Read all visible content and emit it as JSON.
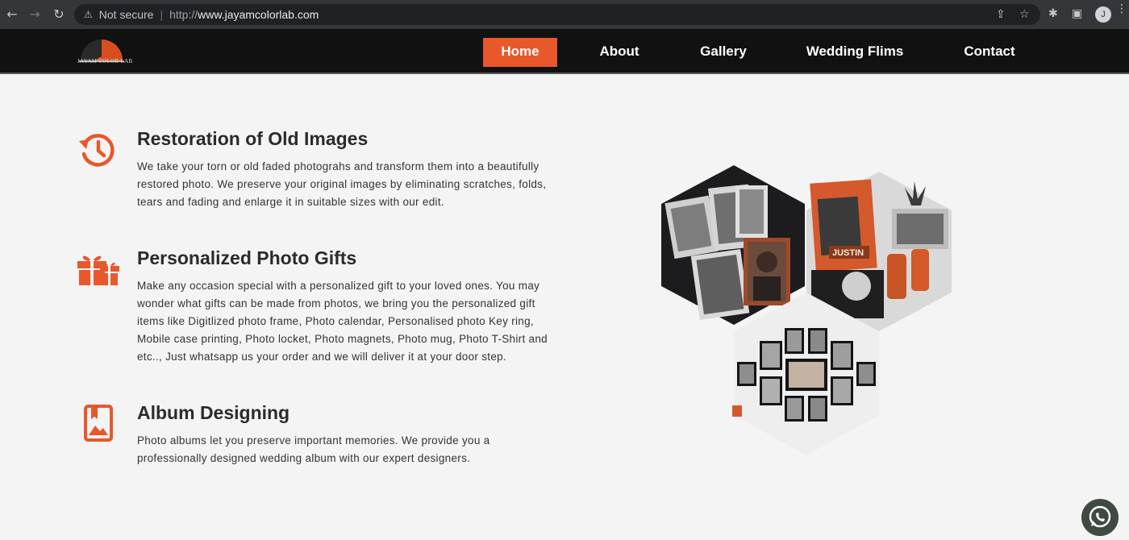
{
  "browser": {
    "security_label": "Not secure",
    "url_prefix": "http://",
    "url_host": "www.jayamcolorlab.com",
    "profile_initial": "J"
  },
  "site": {
    "logo_text": "JAYAM COLOR LAB",
    "nav": [
      {
        "label": "Home",
        "active": true
      },
      {
        "label": "About",
        "active": false
      },
      {
        "label": "Gallery",
        "active": false
      },
      {
        "label": "Wedding Flims",
        "active": false
      },
      {
        "label": "Contact",
        "active": false
      }
    ],
    "accent_color": "#e8582a"
  },
  "features": [
    {
      "icon": "history-icon",
      "title": "Restoration of Old Images",
      "lines": [
        "We take your torn or old faded photograhs and transform them into a beautifully",
        "restored photo. We preserve your original images by eliminating scratches, folds,",
        "tears and fading and enlarge it in suitable sizes with our edit."
      ]
    },
    {
      "icon": "gift-icon",
      "title": "Personalized Photo Gifts",
      "lines": [
        "Make any occasion special with a personalized gift to your loved ones. You may",
        "wonder what gifts can be made from photos, we bring you the personalized gift",
        "items like Digitlized photo frame, Photo calendar, Personalised photo Key ring,",
        "Mobile case printing, Photo locket, Photo magnets, Photo mug, Photo T-Shirt and",
        "etc.., Just whatsapp us your order and we will deliver it at your door step."
      ]
    },
    {
      "icon": "album-icon",
      "title": "Album Designing",
      "lines": [
        "Photo albums let you preserve important memories. We provide you a",
        "professionally designed wedding album with our expert designers."
      ]
    }
  ],
  "collage_text": "JUSTIN"
}
